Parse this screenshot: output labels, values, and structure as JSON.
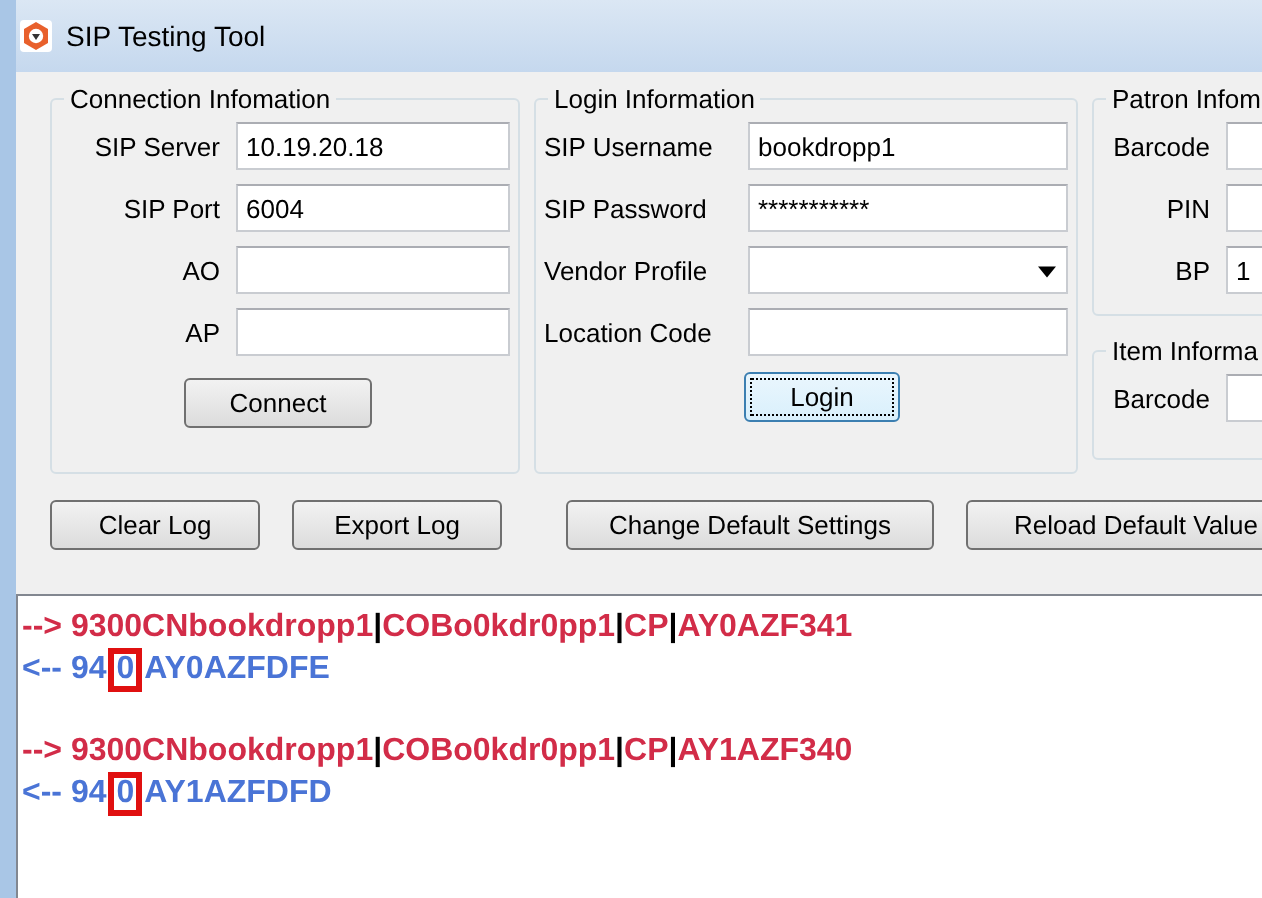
{
  "window": {
    "title": "SIP Testing Tool"
  },
  "connection": {
    "title": "Connection Infomation",
    "fields": [
      {
        "label": "SIP Server",
        "value": "10.19.20.18"
      },
      {
        "label": "SIP Port",
        "value": "6004"
      },
      {
        "label": "AO"
      },
      {
        "label": "AP"
      }
    ],
    "button": "Connect"
  },
  "login": {
    "title": "Login Information",
    "fields": [
      {
        "label": "SIP Username",
        "kind": "text",
        "value": "bookdropp1"
      },
      {
        "label": "SIP Password",
        "kind": "text",
        "value": "***********"
      },
      {
        "label": "Vendor Profile",
        "kind": "dropdown"
      },
      {
        "label": "Location Code",
        "kind": "text"
      }
    ],
    "button": {
      "label": "Login",
      "focused": true
    }
  },
  "patron": {
    "title": "Patron Infom",
    "fields": [
      {
        "label": "Barcode"
      },
      {
        "label": "PIN"
      },
      {
        "label": "BP",
        "value": "1"
      }
    ]
  },
  "item": {
    "title": "Item Informa",
    "fields": [
      {
        "label": "Barcode"
      }
    ]
  },
  "toolbar": [
    {
      "kind": "button",
      "label": "Clear Log"
    },
    {
      "kind": "button",
      "label": "Export Log"
    },
    {
      "kind": "separator"
    },
    {
      "kind": "button",
      "label": "Change Default Settings"
    },
    {
      "kind": "button",
      "label": "Reload Default Value"
    }
  ],
  "log": [
    {
      "kind": "sent",
      "segments": [
        {
          "kind": "text",
          "text": "--> 9300CNbookdropp1"
        },
        {
          "kind": "pipe",
          "text": "|"
        },
        {
          "kind": "text",
          "text": "COBo0kdr0pp1"
        },
        {
          "kind": "pipe",
          "text": "|"
        },
        {
          "kind": "text",
          "text": "CP"
        },
        {
          "kind": "pipe",
          "text": "|"
        },
        {
          "kind": "text",
          "text": "AY0AZF341"
        }
      ]
    },
    {
      "kind": "received",
      "segments": [
        {
          "kind": "text",
          "text": "<-- 94"
        },
        {
          "kind": "text",
          "text": "0",
          "highlighted": true
        },
        {
          "kind": "text",
          "text": "AY0AZFDFE"
        }
      ]
    },
    {
      "kind": "blank"
    },
    {
      "kind": "sent",
      "segments": [
        {
          "kind": "text",
          "text": "--> 9300CNbookdropp1"
        },
        {
          "kind": "pipe",
          "text": "|"
        },
        {
          "kind": "text",
          "text": "COBo0kdr0pp1"
        },
        {
          "kind": "pipe",
          "text": "|"
        },
        {
          "kind": "text",
          "text": "CP"
        },
        {
          "kind": "pipe",
          "text": "|"
        },
        {
          "kind": "text",
          "text": "AY1AZF340"
        }
      ]
    },
    {
      "kind": "received",
      "segments": [
        {
          "kind": "text",
          "text": "<-- 94"
        },
        {
          "kind": "text",
          "text": "0",
          "highlighted": true
        },
        {
          "kind": "text",
          "text": "AY1AZFDFD"
        }
      ]
    }
  ]
}
